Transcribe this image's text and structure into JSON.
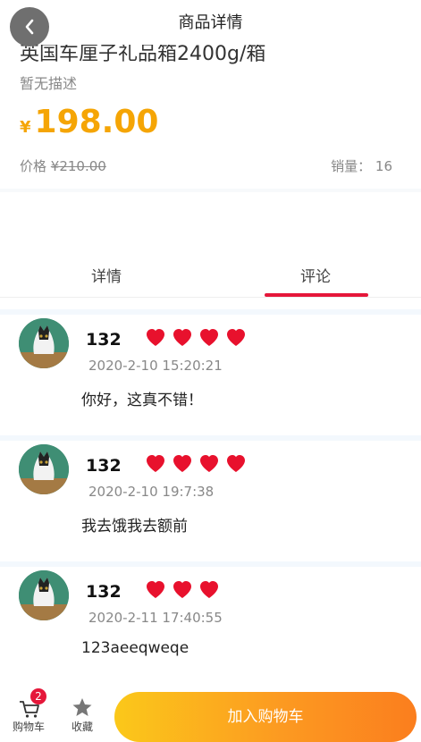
{
  "header": {
    "title": "商品详情"
  },
  "product": {
    "name": "英国车厘子礼品箱2400g/箱",
    "description": "暂无描述",
    "price_symbol": "¥",
    "price": "198.00",
    "original_price_label": "价格",
    "original_price": "¥210.00",
    "sales_label": "销量：",
    "sales": "16"
  },
  "tabs": {
    "detail": "详情",
    "comment": "评论",
    "active": "comment"
  },
  "comments": [
    {
      "user": "132",
      "rating": 4,
      "time": "2020-2-10 15:20:21",
      "text": "你好，这真不错！"
    },
    {
      "user": "132",
      "rating": 4,
      "time": "2020-2-10 19:7:38",
      "text": "我去饿我去额前"
    },
    {
      "user": "132",
      "rating": 3,
      "time": "2020-2-11 17:40:55",
      "text": "123aeeqweqe"
    }
  ],
  "bottom": {
    "cart_label": "购物车",
    "cart_badge": "2",
    "favorite_label": "收藏",
    "add_to_cart": "加入购物车"
  },
  "colors": {
    "price": "#f5a505",
    "accent": "#e5173a",
    "heart": "#e8112d"
  }
}
